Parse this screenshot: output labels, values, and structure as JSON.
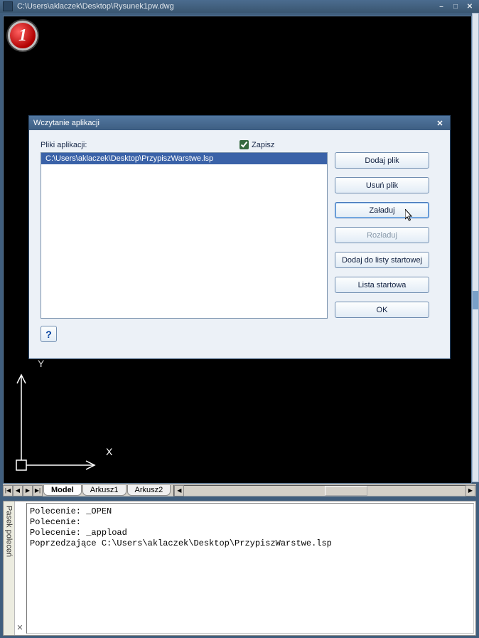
{
  "app": {
    "title": "C:\\Users\\aklaczek\\Desktop\\Rysunek1pw.dwg",
    "marker": "1",
    "axis_y": "Y",
    "axis_x": "X"
  },
  "tabs": {
    "model": "Model",
    "arkusz1": "Arkusz1",
    "arkusz2": "Arkusz2"
  },
  "dialog": {
    "title": "Wczytanie aplikacji",
    "files_label": "Pliki aplikacji:",
    "save_label": "Zapisz",
    "file_row": "C:\\Users\\aklaczek\\Desktop\\PrzypiszWarstwe.lsp",
    "btn_add": "Dodaj plik",
    "btn_remove": "Usuń plik",
    "btn_load": "Załaduj",
    "btn_unload": "Rozładuj",
    "btn_addstart": "Dodaj do listy startowej",
    "btn_startlist": "Lista startowa",
    "btn_ok": "OK",
    "help": "?"
  },
  "command": {
    "side_label": "Pasek poleceń",
    "text": "Polecenie: _OPEN\nPolecenie:\nPolecenie: _appload\nPoprzedzające C:\\Users\\aklaczek\\Desktop\\PrzypiszWarstwe.lsp\n"
  }
}
